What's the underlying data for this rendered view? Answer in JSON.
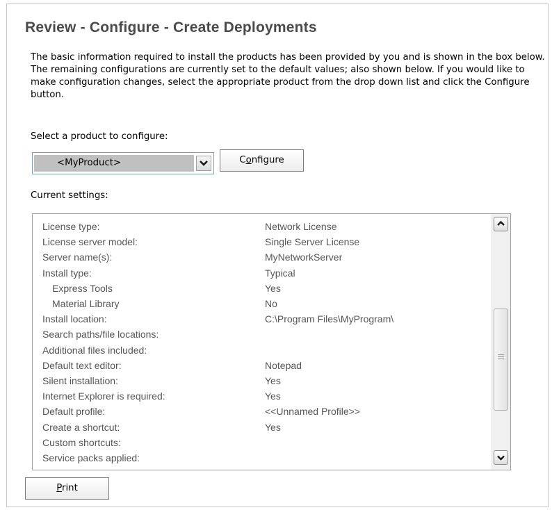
{
  "page": {
    "title": "Review - Configure - Create Deployments",
    "intro": "The basic information required to install the products has been provided by you and is shown in the box below. The remaining configurations are currently set to the default values; also shown below. If you would like to make configuration changes, select the appropriate product from the drop down list and click the Configure button."
  },
  "product_select": {
    "label": "Select a product to configure:",
    "value": "<MyProduct>"
  },
  "buttons": {
    "configure": {
      "before": "C",
      "mnemonic": "o",
      "after": "nfigure"
    },
    "print": {
      "before": "",
      "mnemonic": "P",
      "after": "rint"
    }
  },
  "settings": {
    "label": "Current settings:",
    "rows": [
      {
        "key": "License type:",
        "value": "Network License"
      },
      {
        "key": "License server model:",
        "value": "Single Server License"
      },
      {
        "key": "Server name(s):",
        "value": "MyNetworkServer"
      },
      {
        "key": "Install type:",
        "value": "Typical"
      },
      {
        "key": "Express Tools",
        "value": "Yes"
      },
      {
        "key": "Material Library",
        "value": "No"
      },
      {
        "key": "Install location:",
        "value": "C:\\Program Files\\MyProgram\\"
      },
      {
        "key": "Search paths/file locations:",
        "value": ""
      },
      {
        "key": "Additional files included:",
        "value": ""
      },
      {
        "key": "Default text editor:",
        "value": "Notepad"
      },
      {
        "key": "Silent installation:",
        "value": "Yes"
      },
      {
        "key": "Internet Explorer is required:",
        "value": "Yes"
      },
      {
        "key": "Default profile:",
        "value": "<<Unnamed Profile>>"
      },
      {
        "key": "Create a shortcut:",
        "value": "Yes"
      },
      {
        "key": "Custom shortcuts:",
        "value": ""
      },
      {
        "key": "Service packs applied:",
        "value": ""
      }
    ]
  },
  "icons": {
    "dropdown": "chevron-down-icon",
    "scroll_up": "chevron-up-icon",
    "scroll_down": "chevron-down-icon"
  }
}
